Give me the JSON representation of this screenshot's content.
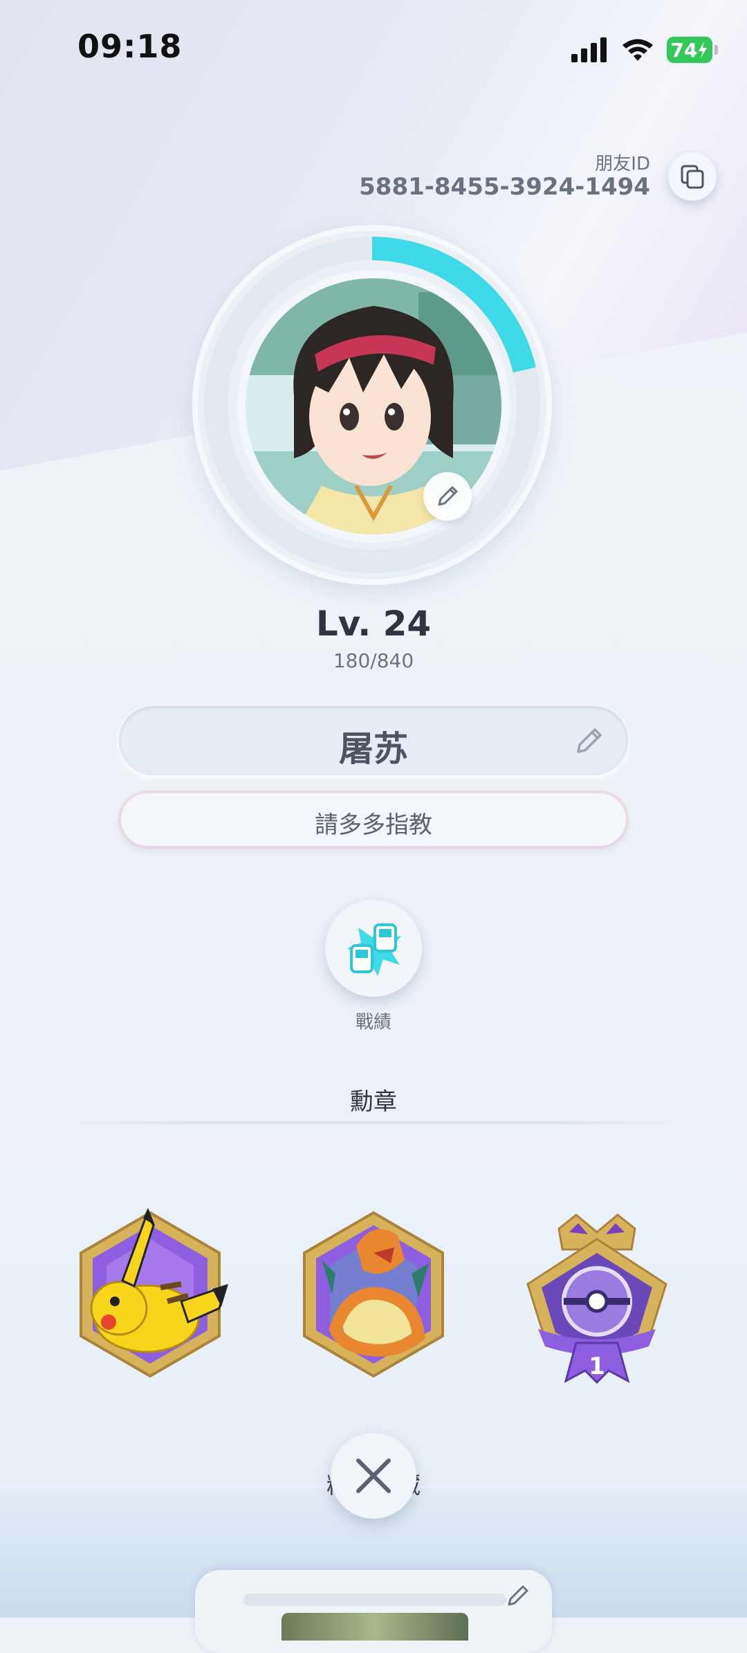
{
  "status": {
    "time": "09:18",
    "battery": "74"
  },
  "friend": {
    "label": "朋友ID",
    "id": "5881-8455-3924-1494"
  },
  "profile": {
    "level": "Lv. 24",
    "exp": "180/840",
    "exp_progress": 0.214,
    "name": "屠苏",
    "motto": "請多多指教"
  },
  "record": {
    "label": "戰績"
  },
  "badges": {
    "title": "勳章",
    "items": [
      {
        "name": "pikachu-badge"
      },
      {
        "name": "charizard-badge"
      },
      {
        "name": "rank-1-crown-badge",
        "rank": "1"
      }
    ]
  },
  "hidden_section": {
    "label": "精選收藏"
  },
  "colors": {
    "accent": "#3fd9e8",
    "badge_purple": "#8e5ee0",
    "gold": "#d6b25a"
  }
}
